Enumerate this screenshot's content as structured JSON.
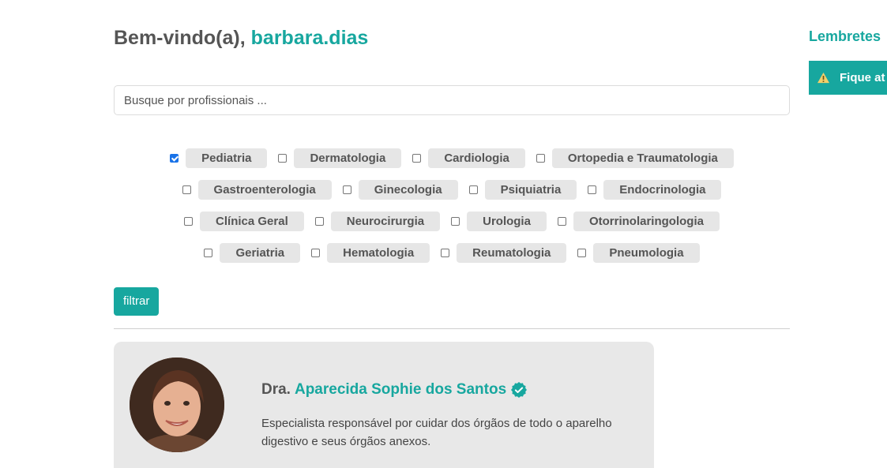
{
  "header": {
    "greeting": "Bem-vindo(a),",
    "username": "barbara.dias"
  },
  "search": {
    "placeholder": "Busque por profissionais ..."
  },
  "filters": {
    "rows": [
      [
        {
          "label": "Pediatria",
          "checked": true
        },
        {
          "label": "Dermatologia",
          "checked": false
        },
        {
          "label": "Cardiologia",
          "checked": false
        },
        {
          "label": "Ortopedia e Traumatologia",
          "checked": false
        }
      ],
      [
        {
          "label": "Gastroenterologia",
          "checked": false
        },
        {
          "label": "Ginecologia",
          "checked": false
        },
        {
          "label": "Psiquiatria",
          "checked": false
        },
        {
          "label": "Endocrinologia",
          "checked": false
        }
      ],
      [
        {
          "label": "Clínica Geral",
          "checked": false
        },
        {
          "label": "Neurocirurgia",
          "checked": false
        },
        {
          "label": "Urologia",
          "checked": false
        },
        {
          "label": "Otorrinolaringologia",
          "checked": false
        }
      ],
      [
        {
          "label": "Geriatria",
          "checked": false
        },
        {
          "label": "Hematologia",
          "checked": false
        },
        {
          "label": "Reumatologia",
          "checked": false
        },
        {
          "label": "Pneumologia",
          "checked": false
        }
      ]
    ],
    "button_label": "filtrar"
  },
  "doctor_card": {
    "prefix": "Dra.",
    "name": "Aparecida Sophie dos Santos",
    "verified_icon": "verified-badge-icon",
    "description": "Especialista responsável por cuidar dos órgãos de todo o aparelho digestivo e seus órgãos anexos."
  },
  "sidebar": {
    "title": "Lembretes",
    "alert_text": "Fique at",
    "alert_icon": "warning-icon"
  },
  "colors": {
    "accent": "#17a79f",
    "tag_bg": "#e6e6e6",
    "card_bg": "#e8e8e8",
    "checkbox_checked": "#1a73e8"
  }
}
